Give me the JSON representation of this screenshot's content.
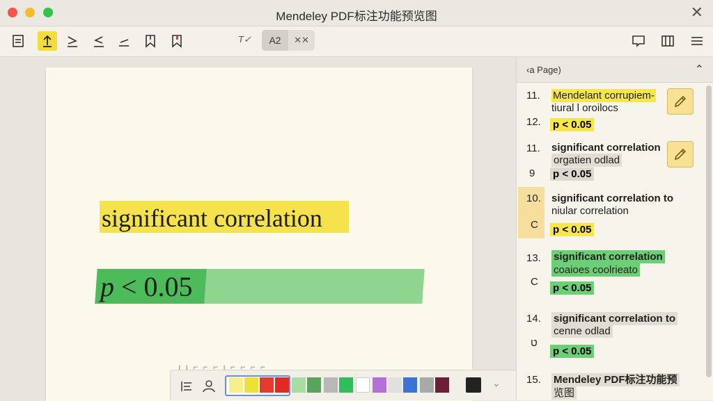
{
  "window": {
    "title": "Mendeley PDF标注功能预览图",
    "close_glyph": "✕"
  },
  "toolbar": {
    "text_tool_label": "T✓",
    "seg_a_label": "A2",
    "seg_b_label": "✕✕"
  },
  "page": {
    "highlight_text": "significant correlation",
    "formula_var": "p",
    "formula_rest": " < 0.05",
    "faint_text": "ı  ı  ⌐ ⌐ ⌐ ı ⌐ ⌐ ⌐ ⌐"
  },
  "colors": {
    "accent_yellow": "#f6e24c",
    "accent_green": "#4dbb5a",
    "accent_light_green": "#8fd48f",
    "palette": [
      "#f7f08a",
      "#efe039",
      "#e53a2f",
      "#e02a22",
      "#a8dca4",
      "#5aa35d",
      "#b8b8b8",
      "#2fbf5a",
      "#ffffff",
      "#b66fd9",
      "#e0e0e0",
      "#3b74d8",
      "#a9a9a9",
      "#6d1f38"
    ]
  },
  "sidebar": {
    "header_label": "‹a  Page)",
    "collapse_glyph": "⌃",
    "annotations": [
      {
        "num": "11.",
        "line1": "Mendelant corrupiem-",
        "line2": "tiural l oroilocs"
      },
      {
        "num": "12.",
        "pill": "p < 0.05"
      },
      {
        "num": "11.",
        "line1": "significant correlation",
        "line2": "orgatien odlad"
      },
      {
        "num": "9",
        "pill": "p < 0.05"
      },
      {
        "num": "10.",
        "line1": "significant correlation  to",
        "line2": "niular correlation"
      },
      {
        "num": "C",
        "pill": "p < 0.05"
      },
      {
        "num": "13.",
        "line1": "significant correlation",
        "line2": "coaioes coolrieato"
      },
      {
        "num": "C",
        "pill": "p < 0.05"
      },
      {
        "num": "14.",
        "line1": "significant correlation  to",
        "line2": "cenne odlad"
      },
      {
        "num": "ט",
        "pill": "p < 0.05"
      },
      {
        "num": "15.",
        "line1": "Mendeley PDF标注功能预",
        "line2": "览图"
      }
    ]
  }
}
